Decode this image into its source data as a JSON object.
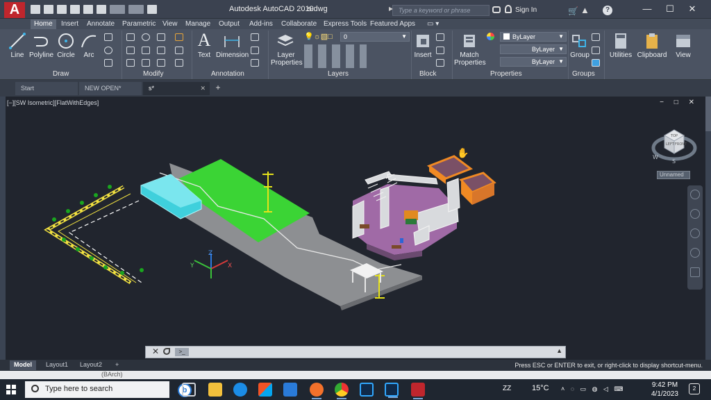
{
  "app": {
    "logo": "A",
    "title": "Autodesk AutoCAD 2019",
    "file": "s.dwg",
    "search_placeholder": "Type a keyword or phrase",
    "sign_in": "Sign In",
    "help": "?"
  },
  "window_controls": {
    "minimize": "—",
    "maximize": "☐",
    "close": "✕"
  },
  "ribbon_tabs": [
    "Home",
    "Insert",
    "Annotate",
    "Parametric",
    "View",
    "Manage",
    "Output",
    "Add-ins",
    "Collaborate",
    "Express Tools",
    "Featured Apps"
  ],
  "ribbon": {
    "draw": {
      "line": "Line",
      "polyline": "Polyline",
      "circle": "Circle",
      "arc": "Arc",
      "title": "Draw"
    },
    "modify": {
      "title": "Modify"
    },
    "annotation": {
      "text": "Text",
      "dimension": "Dimension",
      "title": "Annotation"
    },
    "layers": {
      "layer_properties": "Layer Properties",
      "layer_value": "0",
      "title": "Layers"
    },
    "block": {
      "insert": "Insert",
      "title": "Block"
    },
    "properties": {
      "match": "Match Properties",
      "color": "ByLayer",
      "linetype": "ByLayer",
      "lineweight": "ByLayer",
      "title": "Properties"
    },
    "groups": {
      "group": "Group",
      "title": "Groups"
    },
    "utilities": "Utilities",
    "clipboard": "Clipboard",
    "view": "View"
  },
  "doc_tabs": [
    {
      "label": "Start"
    },
    {
      "label": "NEW OPEN*"
    },
    {
      "label": "s*"
    }
  ],
  "viewport": {
    "label": "[−][SW Isometric][FlatWithEdges]",
    "controls": "− □ ✕",
    "view_cube_top": "TOP",
    "view_cube_left": "LEFT",
    "view_cube_front": "FRONT",
    "compass_s": "S",
    "compass_w": "W",
    "ucs_name": "Unnamed",
    "ucs_x": "X",
    "ucs_y": "Y",
    "ucs_z": "Z"
  },
  "command_line": {
    "close": "✕",
    "prompt": ">_",
    "value": ""
  },
  "layout_tabs": [
    "Model",
    "Layout1",
    "Layout2"
  ],
  "status_message": "Press ESC or ENTER to exit, or right-click to display shortcut-menu.",
  "below_strip_text": "(BArch)",
  "taskbar": {
    "search_placeholder": "Type here to search",
    "bing": "b",
    "tray_zz": "ZZ",
    "weather": "15°C",
    "time": "9:42 PM",
    "date": "4/1/2023",
    "notifications": "2"
  },
  "colors": {
    "accent_red": "#c0262d",
    "grass_green": "#3bd435",
    "water_cyan": "#3fd0dc",
    "floor_purple": "#a06aa6",
    "room_orange": "#f08a24",
    "lamp_yellow": "#e6e21a"
  }
}
